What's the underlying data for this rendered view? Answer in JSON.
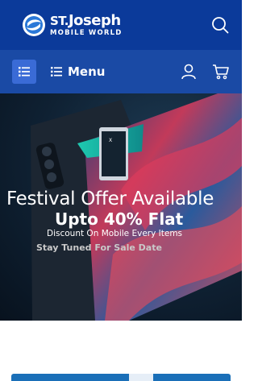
{
  "brand": {
    "name_prefix": "ST.",
    "name": "Joseph",
    "tagline": "MOBILE WORLD",
    "colors": {
      "topbar": "#0b3a9a",
      "navbar": "#1a4aa5",
      "accent": "#3a6bd6"
    }
  },
  "header": {
    "search_icon": "search-icon"
  },
  "nav": {
    "menu_label": "Menu",
    "hamburger_icon": "list-icon",
    "account_icon": "user-icon",
    "cart_icon": "cart-icon"
  },
  "hero": {
    "title": "Festival Offer Available",
    "subtitle": "Upto 40% Flat",
    "description": "Discount On Mobile Every Items",
    "note": "Stay Tuned For Sale Date"
  }
}
